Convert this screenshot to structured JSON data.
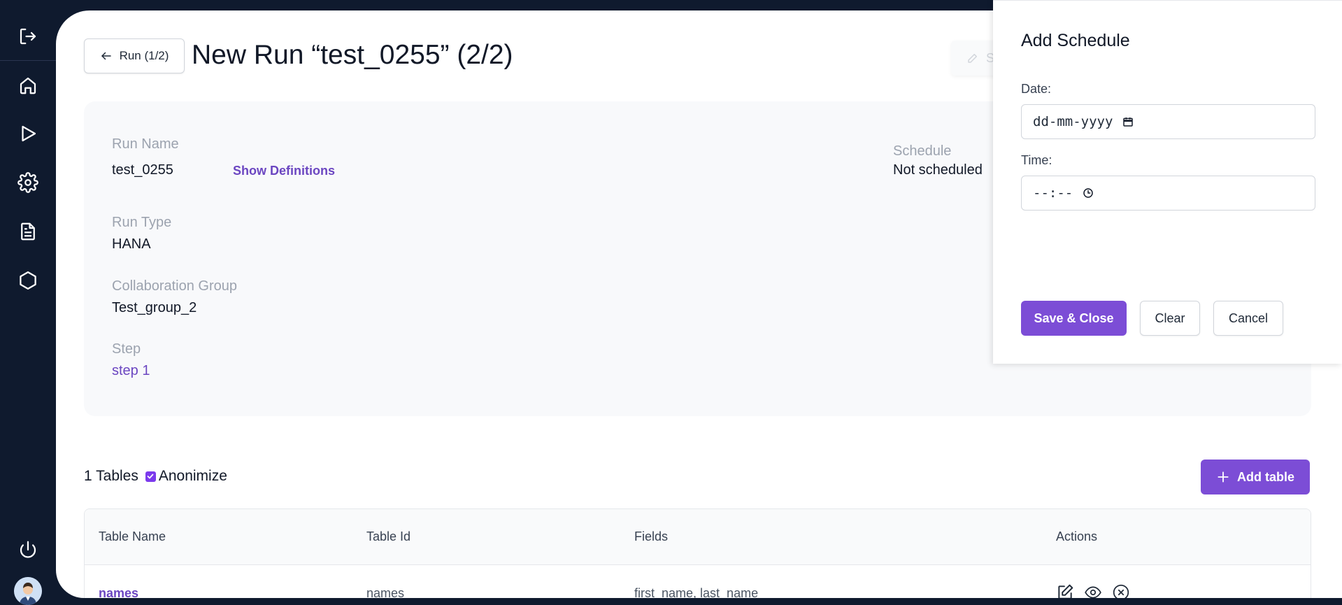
{
  "sidebar": {
    "icons": [
      "logout-icon",
      "home-icon",
      "play-icon",
      "gear-icon",
      "document-icon",
      "hexagon-icon",
      "power-icon"
    ],
    "avatar": "user-avatar"
  },
  "header": {
    "back_label": "Run (1/2)",
    "title": "New Run “test_0255” (2/2)",
    "ghost_button_label": "S"
  },
  "run_info": {
    "run_name_label": "Run Name",
    "run_name_value": "test_0255",
    "show_definitions": "Show Definitions",
    "run_type_label": "Run Type",
    "run_type_value": "HANA",
    "collab_label": "Collaboration Group",
    "collab_value": "Test_group_2",
    "step_label": "Step",
    "step_value": "step 1",
    "schedule_label": "Schedule",
    "schedule_value": "Not scheduled"
  },
  "tables_section": {
    "count_label": "1 Tables",
    "anonimize_label": "Anonimize",
    "anonimize_checked": true,
    "add_table_label": "Add table"
  },
  "table": {
    "columns": [
      "Table Name",
      "Table Id",
      "Fields",
      "Actions"
    ],
    "rows": [
      {
        "name": "names",
        "id": "names",
        "fields": "first_name, last_name",
        "actions": [
          "edit-icon",
          "eye-icon",
          "remove-icon"
        ]
      }
    ]
  },
  "modal": {
    "title": "Add Schedule",
    "date_label": "Date:",
    "date_placeholder": "dd-mm-yyyy",
    "time_label": "Time:",
    "time_placeholder": "--:--",
    "save_label": "Save & Close",
    "clear_label": "Clear",
    "cancel_label": "Cancel"
  },
  "colors": {
    "sidebar_bg": "#0f1a2e",
    "accent": "#7c4dd6",
    "link": "#6b46c1"
  }
}
